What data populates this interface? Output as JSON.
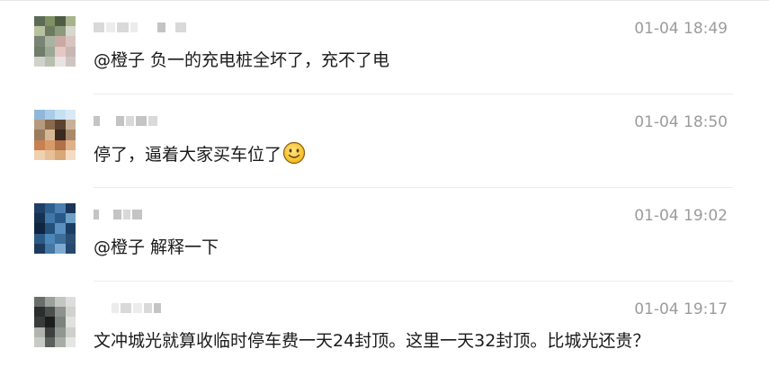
{
  "messages": [
    {
      "time": "01-04 18:49",
      "text": "@橙子 负一的充电桩全坏了，充不了电",
      "avatar_colors": [
        "#5b6b58",
        "#7f9160",
        "#4d5c44",
        "#a8b38c",
        "#b9c29e",
        "#6c7a5e",
        "#8c9a7a",
        "#d6d8cf",
        "#7a8474",
        "#aab3a2",
        "#c9a9a4",
        "#d9c5c0",
        "#6f7d6a",
        "#9da894",
        "#e3c8c4",
        "#c8b7b3",
        "#d0d3cc",
        "#b7c0ae",
        "#e8e4e2",
        "#cfc4c1"
      ]
    },
    {
      "time": "01-04 18:50",
      "text": "停了，逼着大家买车位了",
      "emoji": "smile-emoji",
      "avatar_colors": [
        "#8fb8d8",
        "#a9cde8",
        "#c6e0f2",
        "#d8e9f5",
        "#b69a7e",
        "#8a6a4c",
        "#5a4430",
        "#c8b098",
        "#9a7c5e",
        "#d4b896",
        "#3a2a20",
        "#a88a6a",
        "#c88050",
        "#d89a68",
        "#b07048",
        "#e0b088",
        "#f0d0b0",
        "#e8c098",
        "#d8a878",
        "#f4dcc4"
      ]
    },
    {
      "time": "01-04 19:02",
      "text": "@橙子 解释一下",
      "avatar_colors": [
        "#1e3f66",
        "#2f5f8f",
        "#4a7fb0",
        "#1a3558",
        "#16304f",
        "#3f78a8",
        "#2a5888",
        "#6ea0c8",
        "#0f2540",
        "#24507c",
        "#5b8fbf",
        "#1b3d63",
        "#2c5a86",
        "#4d86b8",
        "#3c6e9c",
        "#2a4e74",
        "#1d3a5c",
        "#4478a4",
        "#7eaad0",
        "#24486e"
      ]
    },
    {
      "time": "01-04 19:17",
      "text": "文冲城光就算收临时停车费一天24封顶。这里一天32封顶。比城光还贵？",
      "avatar_colors": [
        "#6a6e6a",
        "#9aa09a",
        "#c4c6c2",
        "#dcdedb",
        "#2a2e2c",
        "#4a504c",
        "#8c928c",
        "#d0d2ce",
        "#383c3a",
        "#1c1e1d",
        "#7c827c",
        "#e0e2df",
        "#b0b4ae",
        "#3c403e",
        "#909690",
        "#cdd0cb",
        "#c8cac5",
        "#5a605c",
        "#a8aca6",
        "#e4e6e3"
      ]
    }
  ]
}
